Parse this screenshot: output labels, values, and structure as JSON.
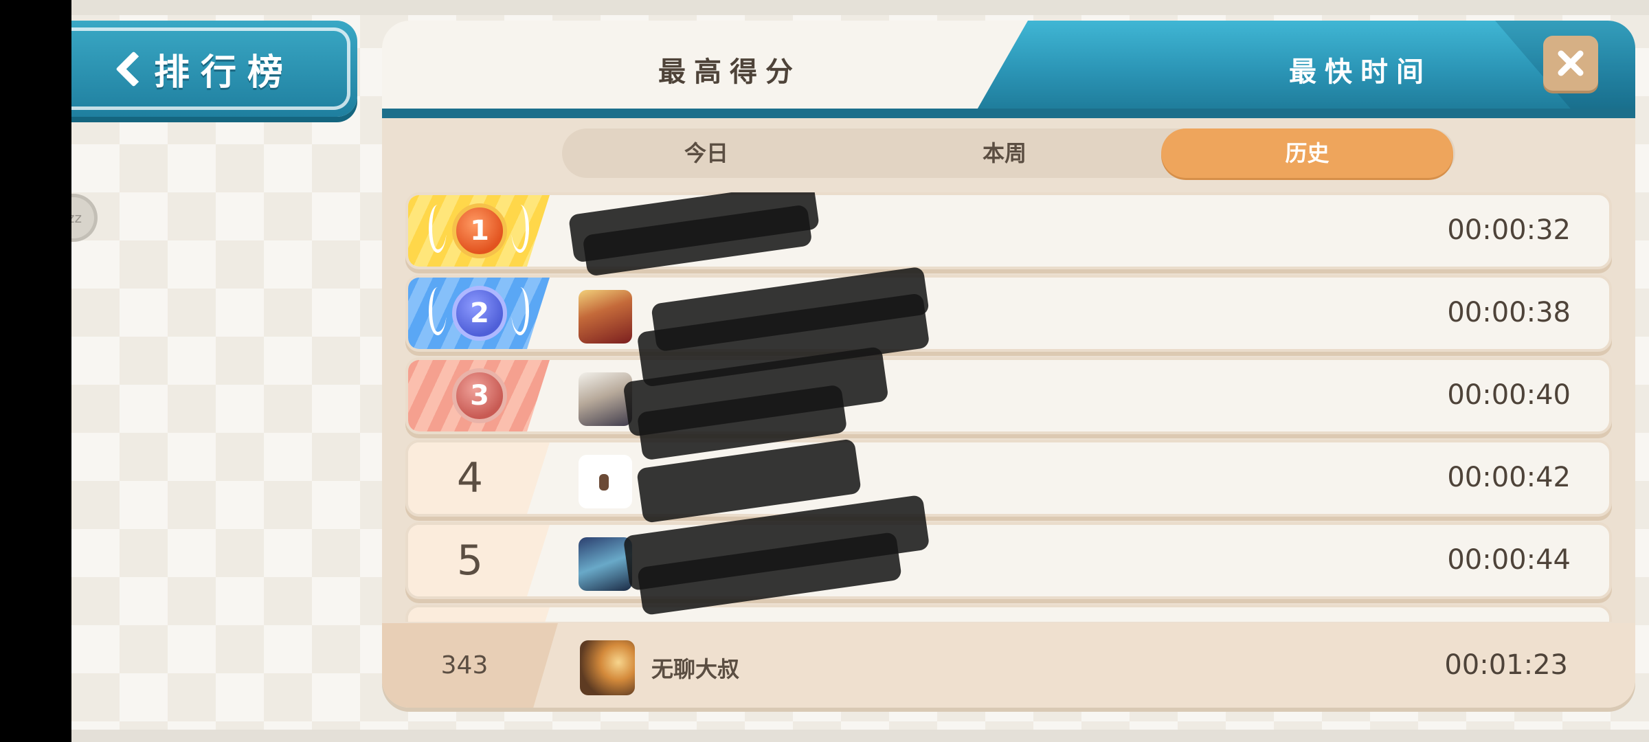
{
  "header": {
    "back_label": "排行榜",
    "side_badge": "zz"
  },
  "tabs": {
    "score": "最高得分",
    "time": "最快时间",
    "active": "time"
  },
  "periods": {
    "today": "今日",
    "week": "本周",
    "history": "历史",
    "active": "history"
  },
  "rows": [
    {
      "rank": "1",
      "name": "",
      "time": "00:00:32",
      "medal": "gold"
    },
    {
      "rank": "2",
      "name": "",
      "time": "00:00:38",
      "medal": "silver"
    },
    {
      "rank": "3",
      "name": "",
      "time": "00:00:40",
      "medal": "bronze"
    },
    {
      "rank": "4",
      "name": "",
      "time": "00:00:42"
    },
    {
      "rank": "5",
      "name": "",
      "time": "00:00:44"
    }
  ],
  "my_entry": {
    "rank": "343",
    "name": "无聊大叔",
    "time": "00:01:23"
  },
  "colors": {
    "accent_teal": "#2a93b4",
    "accent_orange": "#eea55c",
    "gold": "#ffd74a",
    "silver_blue": "#5aa7f5",
    "bronze": "#f5a08f"
  },
  "icons": [
    "back-chevron-icon",
    "close-icon",
    "medal-icon",
    "laurel-wreath-icon"
  ]
}
